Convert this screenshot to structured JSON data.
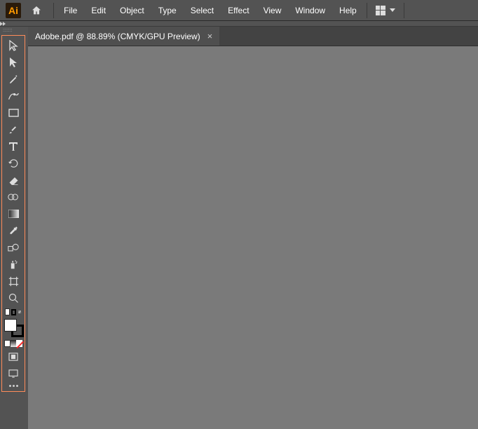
{
  "app": {
    "logo": "Ai"
  },
  "menu": {
    "file": "File",
    "edit": "Edit",
    "object": "Object",
    "type": "Type",
    "select": "Select",
    "effect": "Effect",
    "view": "View",
    "window": "Window",
    "help": "Help"
  },
  "document": {
    "tab_title": "Adobe.pdf @ 88.89% (CMYK/GPU Preview)"
  },
  "colors": {
    "fill": "#ffffff",
    "stroke": "#000000",
    "highlight": "#ff8c5a"
  }
}
